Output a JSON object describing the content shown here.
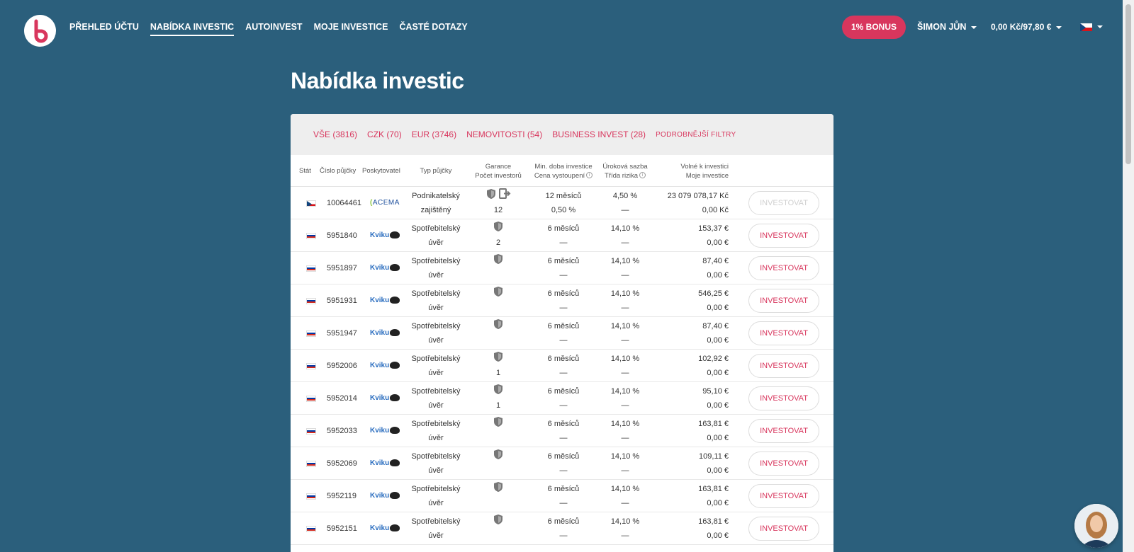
{
  "nav": {
    "links": [
      "PŘEHLED ÚČTU",
      "NABÍDKA INVESTIC",
      "AUTOINVEST",
      "MOJE INVESTICE",
      "ČASTÉ DOTAZY"
    ],
    "bonus": "1% BONUS",
    "user": "ŠIMON JŮN",
    "balance": "0,00 Kč/97,80 €"
  },
  "page": {
    "title": "Nabídka investic"
  },
  "filters": [
    "VŠE (3816)",
    "CZK (70)",
    "EUR (3746)",
    "NEMOVITOSTI (54)",
    "BUSINESS INVEST (28)",
    "PODROBNĚJŠÍ FILTRY"
  ],
  "columns": {
    "country": "Stát",
    "loan_no": "Číslo půjčky",
    "provider": "Poskytovatel",
    "type": "Typ půjčky",
    "guarantee": "Garance",
    "investors": "Počet investorů",
    "min_period": "Min. doba investice",
    "exit_price": "Cena vystoupení",
    "rate": "Úroková sazba",
    "risk": "Třída rizika",
    "available": "Volné k investici",
    "my_investment": "Moje investice"
  },
  "button_label": "INVESTOVAT",
  "rows": [
    {
      "country": "cz",
      "id": "10064461",
      "provider": "ACEMA",
      "type1": "Podnikatelský",
      "type2": "zajištěný",
      "investors": "12",
      "period": "12 měsíců",
      "exit": "0,50 %",
      "rate": "4,50 %",
      "risk": "—",
      "available": "23 079 078,17 Kč",
      "mine": "0,00 Kč",
      "disabled": true,
      "exit_icon": true
    },
    {
      "country": "ru",
      "id": "5951840",
      "provider": "Kviku",
      "type1": "Spotřebitelský",
      "type2": "úvěr",
      "investors": "2",
      "period": "6 měsíců",
      "exit": "—",
      "rate": "14,10 %",
      "risk": "—",
      "available": "153,37 €",
      "mine": "0,00 €"
    },
    {
      "country": "ru",
      "id": "5951897",
      "provider": "Kviku",
      "type1": "Spotřebitelský",
      "type2": "úvěr",
      "investors": "",
      "period": "6 měsíců",
      "exit": "—",
      "rate": "14,10 %",
      "risk": "—",
      "available": "87,40 €",
      "mine": "0,00 €"
    },
    {
      "country": "ru",
      "id": "5951931",
      "provider": "Kviku",
      "type1": "Spotřebitelský",
      "type2": "úvěr",
      "investors": "",
      "period": "6 měsíců",
      "exit": "—",
      "rate": "14,10 %",
      "risk": "—",
      "available": "546,25 €",
      "mine": "0,00 €"
    },
    {
      "country": "ru",
      "id": "5951947",
      "provider": "Kviku",
      "type1": "Spotřebitelský",
      "type2": "úvěr",
      "investors": "",
      "period": "6 měsíců",
      "exit": "—",
      "rate": "14,10 %",
      "risk": "—",
      "available": "87,40 €",
      "mine": "0,00 €"
    },
    {
      "country": "ru",
      "id": "5952006",
      "provider": "Kviku",
      "type1": "Spotřebitelský",
      "type2": "úvěr",
      "investors": "1",
      "period": "6 měsíců",
      "exit": "—",
      "rate": "14,10 %",
      "risk": "—",
      "available": "102,92 €",
      "mine": "0,00 €"
    },
    {
      "country": "ru",
      "id": "5952014",
      "provider": "Kviku",
      "type1": "Spotřebitelský",
      "type2": "úvěr",
      "investors": "1",
      "period": "6 měsíců",
      "exit": "—",
      "rate": "14,10 %",
      "risk": "—",
      "available": "95,10 €",
      "mine": "0,00 €"
    },
    {
      "country": "ru",
      "id": "5952033",
      "provider": "Kviku",
      "type1": "Spotřebitelský",
      "type2": "úvěr",
      "investors": "",
      "period": "6 měsíců",
      "exit": "—",
      "rate": "14,10 %",
      "risk": "—",
      "available": "163,81 €",
      "mine": "0,00 €"
    },
    {
      "country": "ru",
      "id": "5952069",
      "provider": "Kviku",
      "type1": "Spotřebitelský",
      "type2": "úvěr",
      "investors": "",
      "period": "6 měsíců",
      "exit": "—",
      "rate": "14,10 %",
      "risk": "—",
      "available": "109,11 €",
      "mine": "0,00 €"
    },
    {
      "country": "ru",
      "id": "5952119",
      "provider": "Kviku",
      "type1": "Spotřebitelský",
      "type2": "úvěr",
      "investors": "",
      "period": "6 měsíců",
      "exit": "—",
      "rate": "14,10 %",
      "risk": "—",
      "available": "163,81 €",
      "mine": "0,00 €"
    },
    {
      "country": "ru",
      "id": "5952151",
      "provider": "Kviku",
      "type1": "Spotřebitelský",
      "type2": "úvěr",
      "investors": "",
      "period": "6 měsíců",
      "exit": "—",
      "rate": "14,10 %",
      "risk": "—",
      "available": "163,81 €",
      "mine": "0,00 €"
    }
  ],
  "colors": {
    "background": "#2b5f7c",
    "accent": "#d8365d"
  }
}
